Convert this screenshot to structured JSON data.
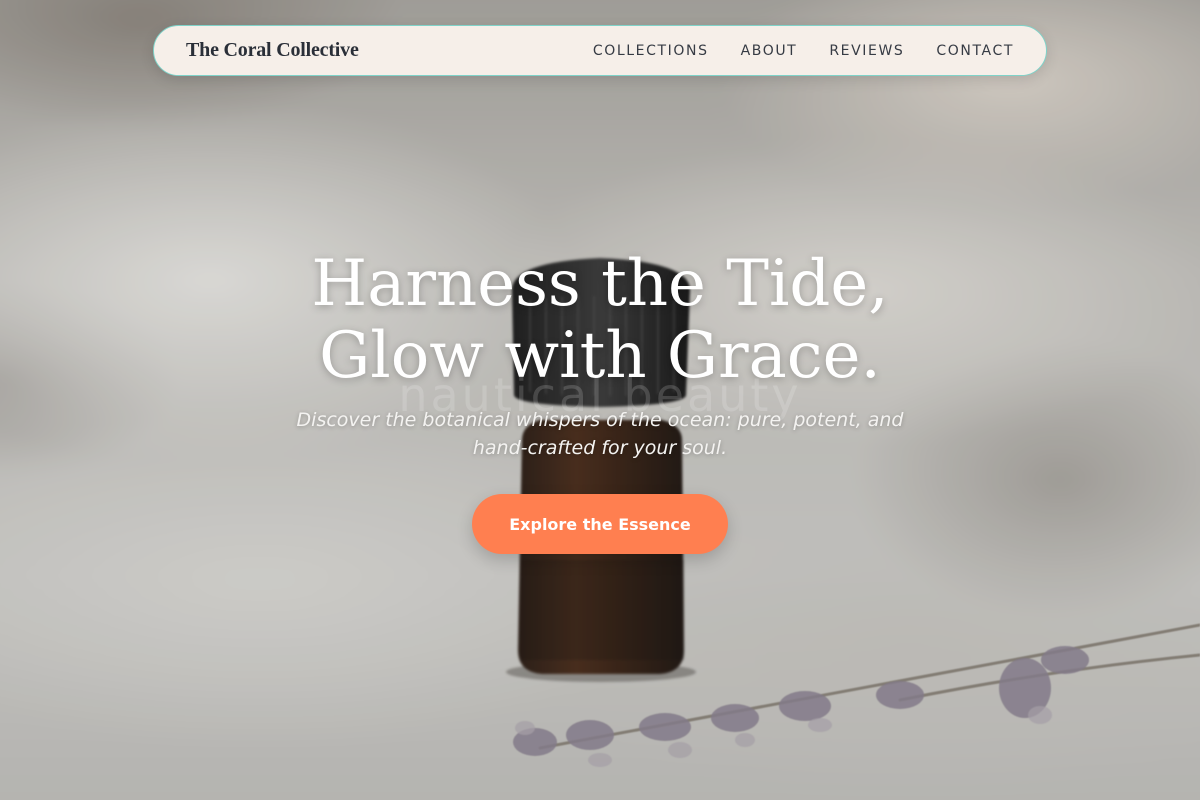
{
  "nav": {
    "brand": "The Coral Collective",
    "links": [
      "COLLECTIONS",
      "ABOUT",
      "REVIEWS",
      "CONTACT"
    ]
  },
  "hero": {
    "title_line1": "Harness the Tide,",
    "title_line2": "Glow with Grace.",
    "ghost_text": "nautical beauty",
    "subtitle": "Discover the botanical whispers of the ocean: pure, potent, and hand-crafted for your soul.",
    "cta_label": "Explore the Essence"
  },
  "colors": {
    "accent": "#ff7f50",
    "nav_background": "#f6efe9",
    "nav_border": "#7fd3c9",
    "text_dark": "#2a2f38"
  },
  "background_image": "amber essential oil bottle on linen cloth with lavender sprigs"
}
